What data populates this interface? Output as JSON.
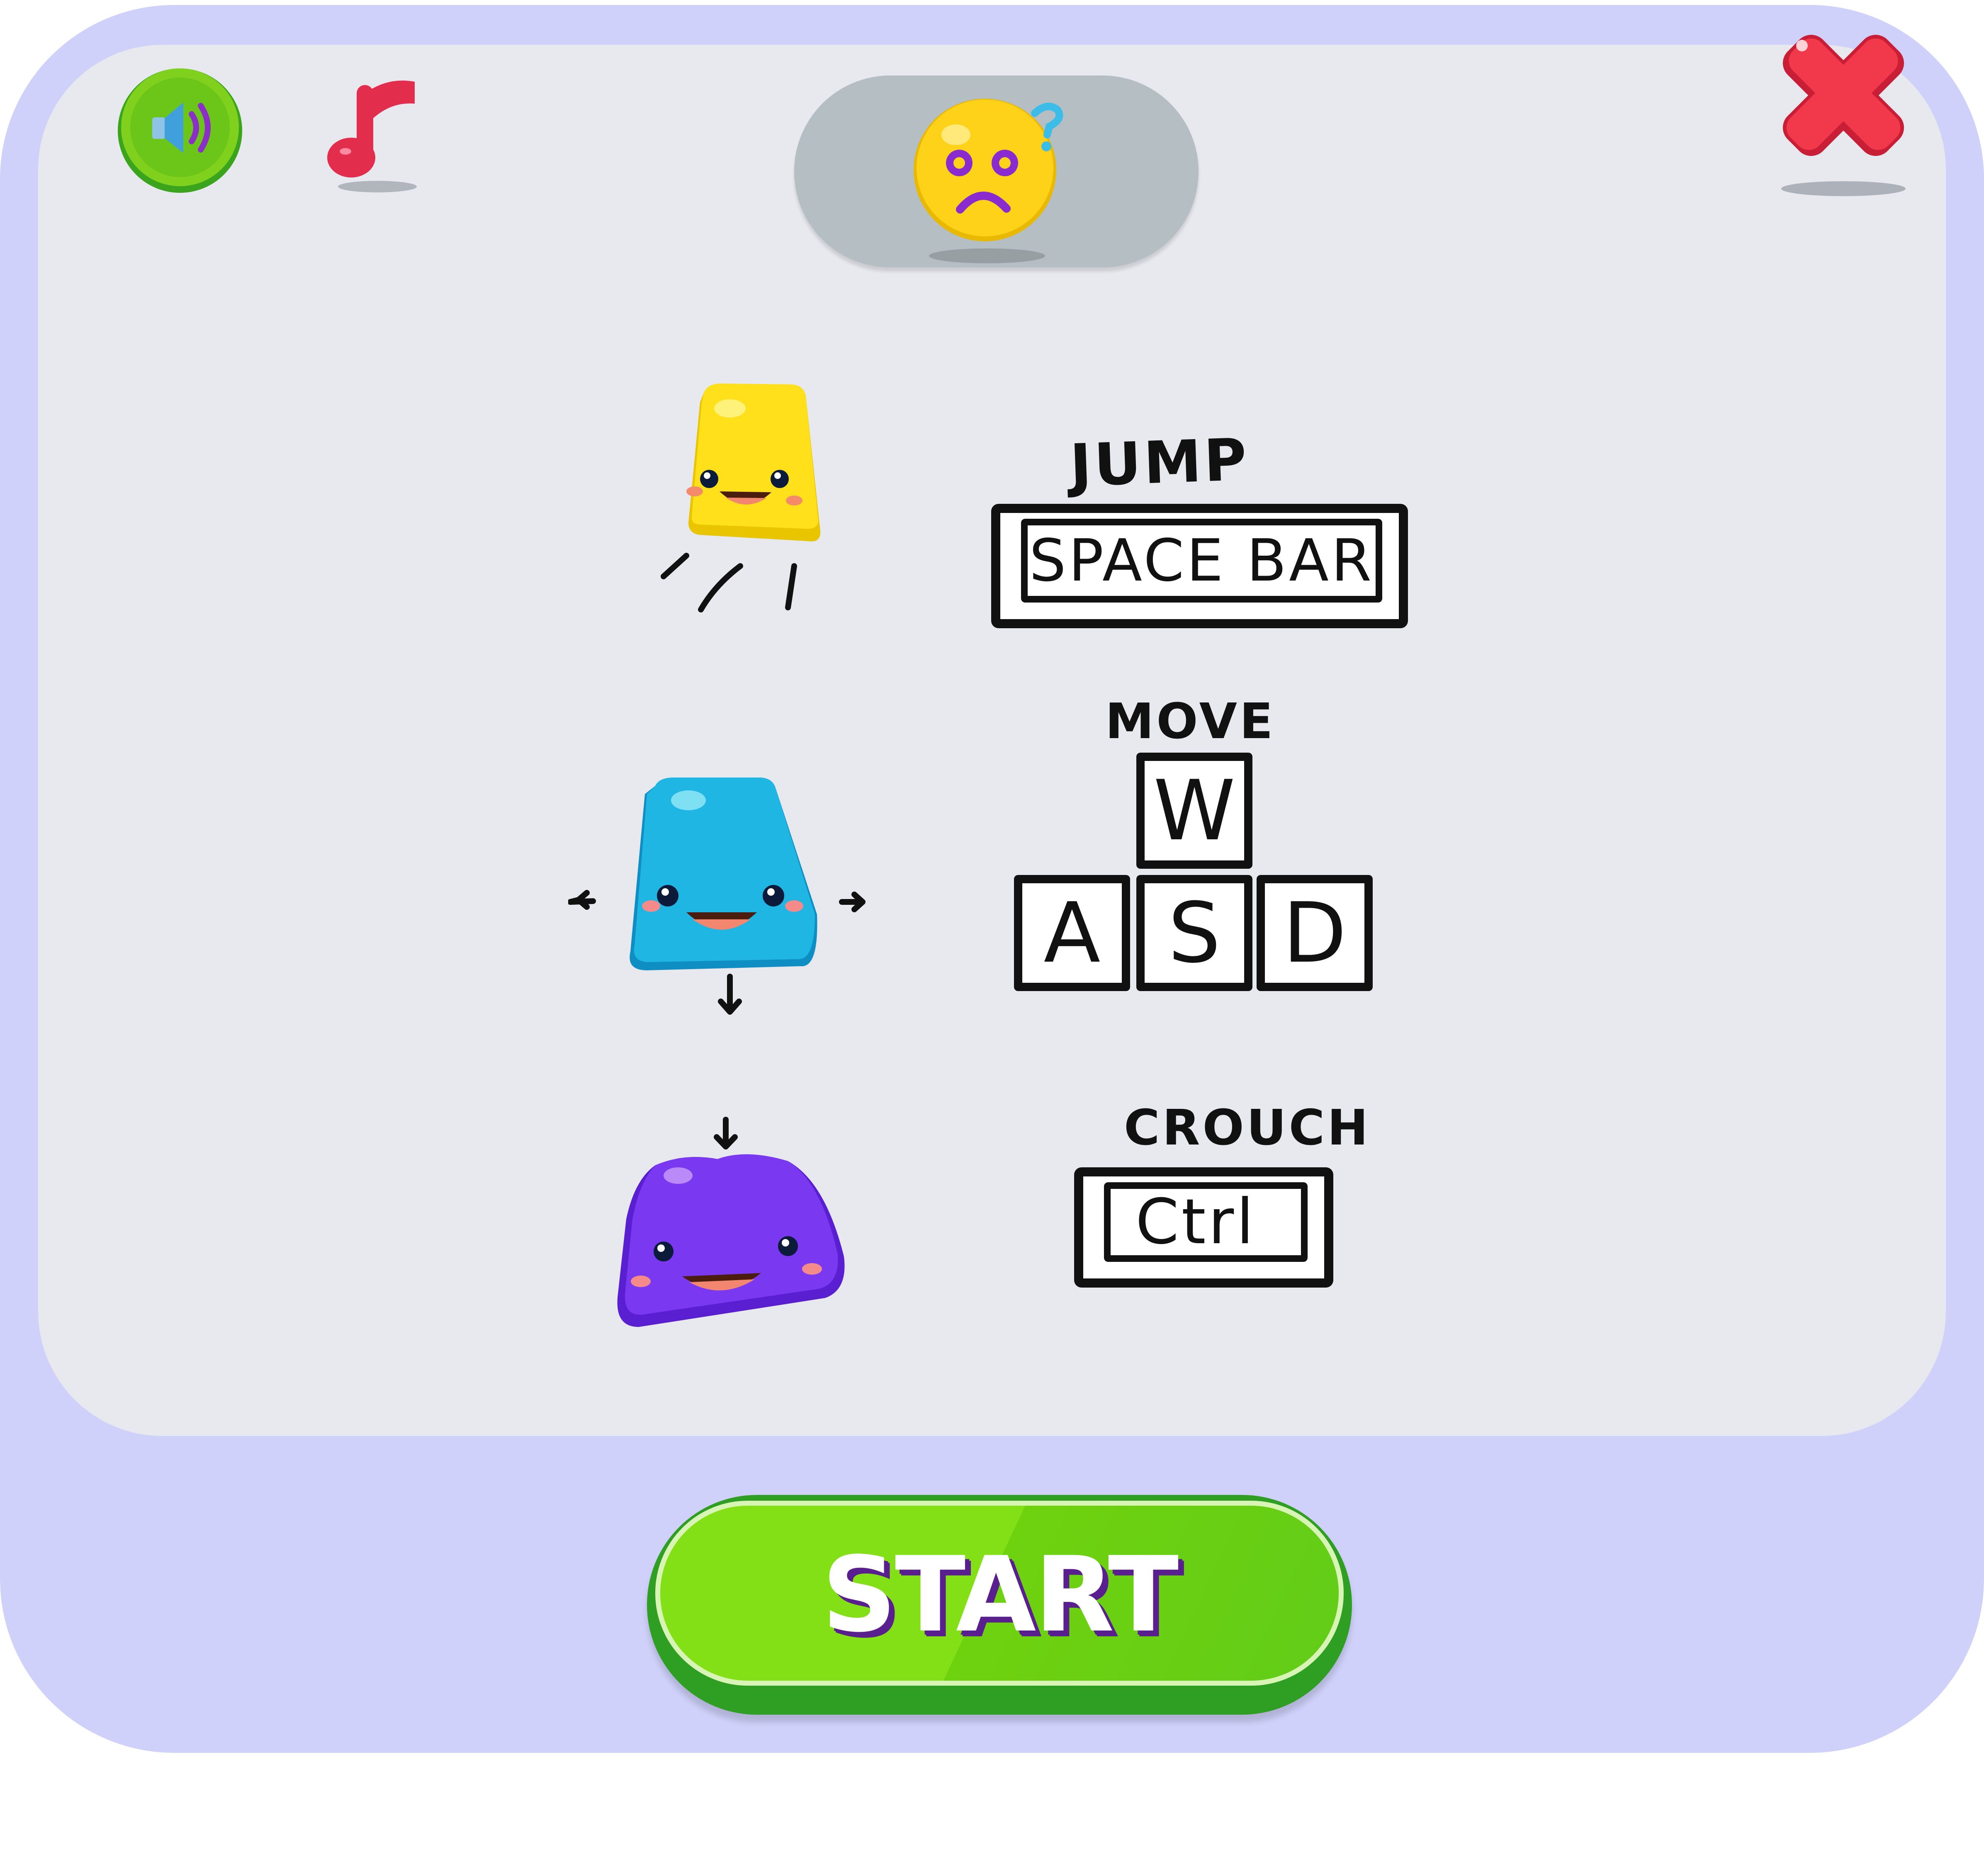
{
  "controls": {
    "jump": {
      "label": "JUMP",
      "key": "SPACE BAR"
    },
    "move": {
      "label": "MOVE",
      "keys": {
        "up": "W",
        "left": "A",
        "down": "S",
        "right": "D"
      }
    },
    "crouch": {
      "label": "CROUCH",
      "key": "Ctrl"
    }
  },
  "start_button": {
    "label": "START"
  },
  "icons": {
    "sound": "speaker-icon",
    "music": "music-note-icon",
    "close": "close-icon",
    "mood": "confused-face-icon"
  },
  "colors": {
    "frame": "#cfd1fb",
    "panel": "#e8e9ee",
    "start_green": "#84e016",
    "start_text_shadow": "#5a1f8f",
    "close_red": "#ee3847",
    "char_yellow": "#f7d900",
    "char_blue": "#1aaee0",
    "char_purple": "#6a2ee6"
  }
}
